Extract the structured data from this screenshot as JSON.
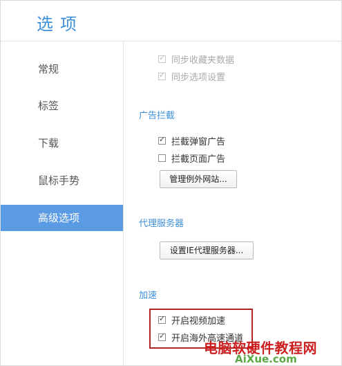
{
  "window": {
    "title": "选项"
  },
  "sidebar": {
    "items": [
      {
        "label": "常规"
      },
      {
        "label": "标签"
      },
      {
        "label": "下载"
      },
      {
        "label": "鼠标手势"
      },
      {
        "label": "高级选项",
        "active": true
      }
    ]
  },
  "sync": {
    "items": [
      {
        "label": "同步收藏夹数据",
        "checked": true,
        "disabled": true
      },
      {
        "label": "同步选项设置",
        "checked": true,
        "disabled": true
      }
    ]
  },
  "adblock": {
    "title": "广告拦截",
    "items": [
      {
        "label": "拦截弹窗广告",
        "checked": true
      },
      {
        "label": "拦截页面广告",
        "checked": false
      }
    ],
    "manage_button": "管理例外网站..."
  },
  "proxy": {
    "title": "代理服务器",
    "button": "设置IE代理服务器..."
  },
  "acceleration": {
    "title": "加速",
    "items": [
      {
        "label": "开启视频加速",
        "checked": true
      },
      {
        "label": "开启海外高速通道",
        "checked": true
      }
    ]
  },
  "watermark": {
    "cn": "电脑软硬件教程网",
    "en": "AiXue.com"
  },
  "colors": {
    "accent": "#3d8fd9",
    "active_nav_bg": "#5b9be4",
    "highlight_border": "#b22222"
  }
}
